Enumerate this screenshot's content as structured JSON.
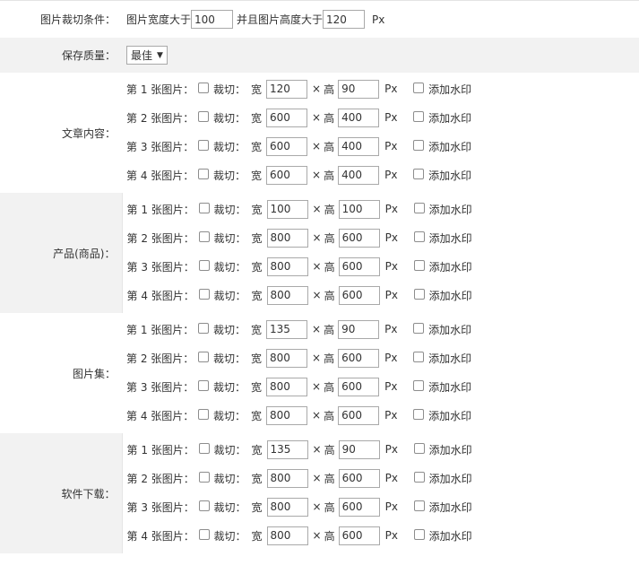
{
  "condition": {
    "label": "图片裁切条件：",
    "width_prefix": "图片宽度大于",
    "min_width": "100",
    "height_prefix": "并且图片高度大于",
    "min_height": "120",
    "unit": "Px"
  },
  "quality": {
    "label": "保存质量：",
    "selected": "最佳",
    "arrow": "▼"
  },
  "common": {
    "crop_label": "裁切：",
    "width_label": "宽",
    "times": "×",
    "height_label": "高",
    "unit": "Px",
    "watermark_label": "添加水印"
  },
  "groups": [
    {
      "label": "文章内容：",
      "rows": [
        {
          "index": "第 1 张图片：",
          "width": "120",
          "height": "90"
        },
        {
          "index": "第 2 张图片：",
          "width": "600",
          "height": "400"
        },
        {
          "index": "第 3 张图片：",
          "width": "600",
          "height": "400"
        },
        {
          "index": "第 4 张图片：",
          "width": "600",
          "height": "400"
        }
      ]
    },
    {
      "label": "产品(商品)：",
      "rows": [
        {
          "index": "第 1 张图片：",
          "width": "100",
          "height": "100"
        },
        {
          "index": "第 2 张图片：",
          "width": "800",
          "height": "600"
        },
        {
          "index": "第 3 张图片：",
          "width": "800",
          "height": "600"
        },
        {
          "index": "第 4 张图片：",
          "width": "800",
          "height": "600"
        }
      ]
    },
    {
      "label": "图片集：",
      "rows": [
        {
          "index": "第 1 张图片：",
          "width": "135",
          "height": "90"
        },
        {
          "index": "第 2 张图片：",
          "width": "800",
          "height": "600"
        },
        {
          "index": "第 3 张图片：",
          "width": "800",
          "height": "600"
        },
        {
          "index": "第 4 张图片：",
          "width": "800",
          "height": "600"
        }
      ]
    },
    {
      "label": "软件下载：",
      "rows": [
        {
          "index": "第 1 张图片：",
          "width": "135",
          "height": "90"
        },
        {
          "index": "第 2 张图片：",
          "width": "800",
          "height": "600"
        },
        {
          "index": "第 3 张图片：",
          "width": "800",
          "height": "600"
        },
        {
          "index": "第 4 张图片：",
          "width": "800",
          "height": "600"
        }
      ]
    }
  ]
}
